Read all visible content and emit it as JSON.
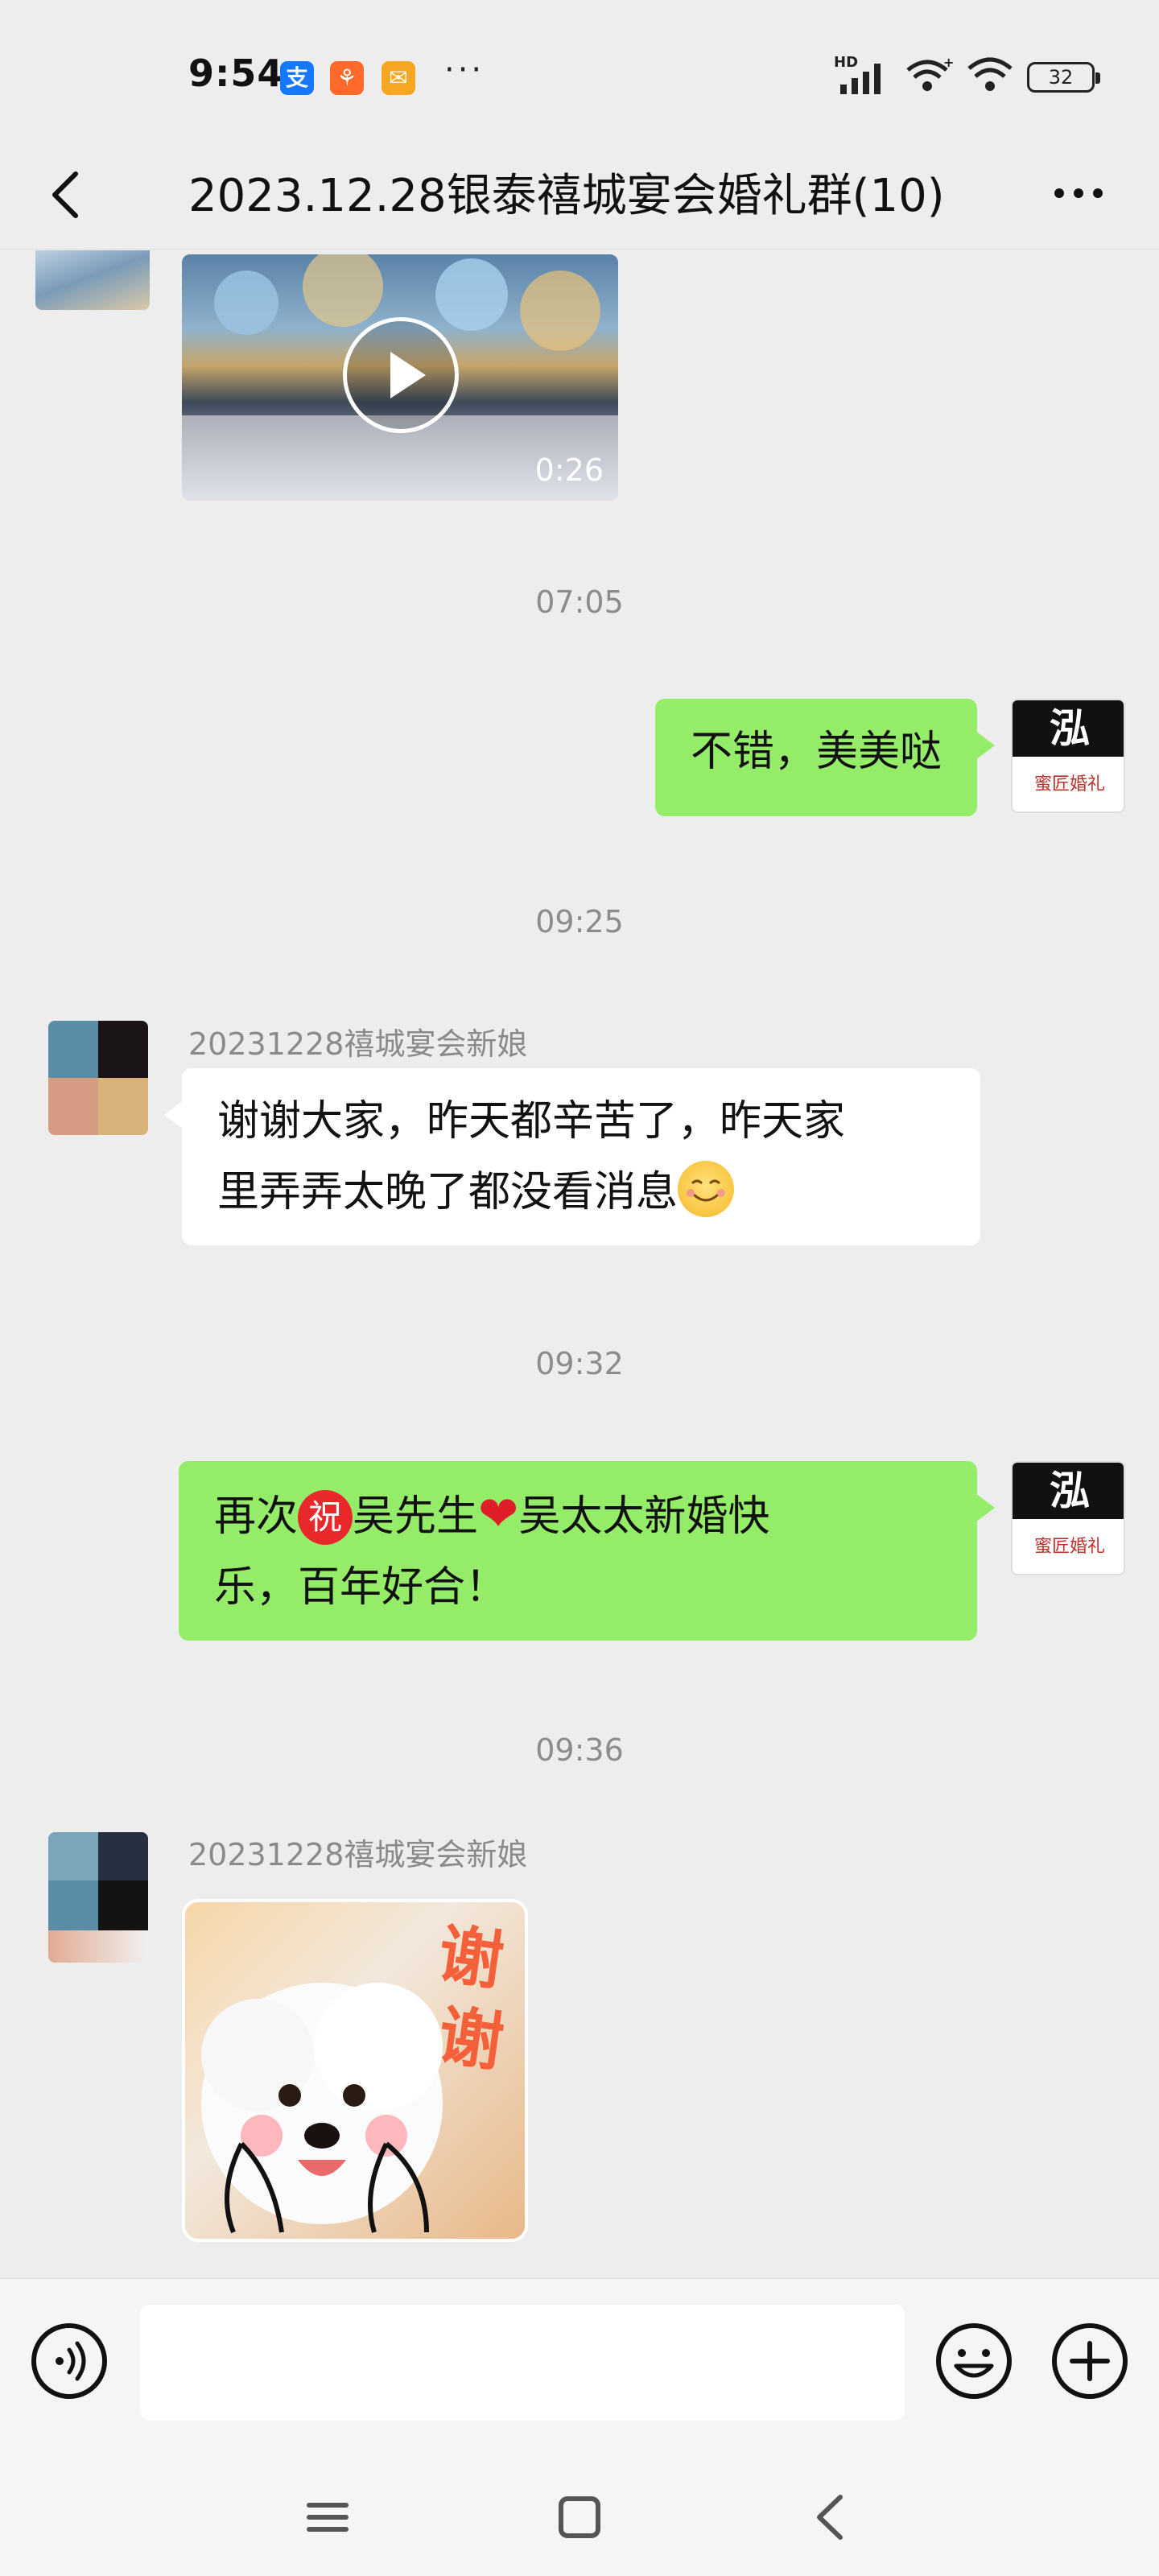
{
  "status_bar": {
    "time": "9:54",
    "apps": [
      {
        "name": "alipay-icon",
        "glyph": "支",
        "color": "#1677ff"
      },
      {
        "name": "taobao-icon",
        "glyph": "⚘",
        "color": "#ff6a2b"
      },
      {
        "name": "mail-icon",
        "glyph": "✉",
        "color": "#f5a623"
      }
    ],
    "more": "···",
    "battery": "32",
    "signal_label": "HD"
  },
  "nav": {
    "title": "2023.12.28银泰禧城宴会婚礼群(10)"
  },
  "messages": {
    "video": {
      "duration": "0:26"
    },
    "ts1": "07:05",
    "m1": {
      "text": "不错，美美哒"
    },
    "ts2": "09:25",
    "m2": {
      "sender": "20231228禧城宴会新娘",
      "line1": "谢谢大家，昨天都辛苦了，昨天家",
      "line2": "里弄弄太晚了都没看消息"
    },
    "ts3": "09:32",
    "m3": {
      "part1": "再次",
      "zhu": "祝",
      "part2": "吴先生",
      "heart": "❤",
      "part3": "吴太太新婚快",
      "line2": "乐，百年好合！"
    },
    "ts4": "09:36",
    "m4": {
      "sender": "20231228禧城宴会新娘",
      "sticker_text1": "谢",
      "sticker_text2": "谢"
    }
  },
  "my_avatar": {
    "brand": "蜜匠婚礼",
    "logo_glyph": "泓"
  },
  "input": {
    "placeholder": ""
  },
  "colors": {
    "bg": "#ededed",
    "out_bubble": "#95ec69",
    "in_bubble": "#ffffff"
  }
}
